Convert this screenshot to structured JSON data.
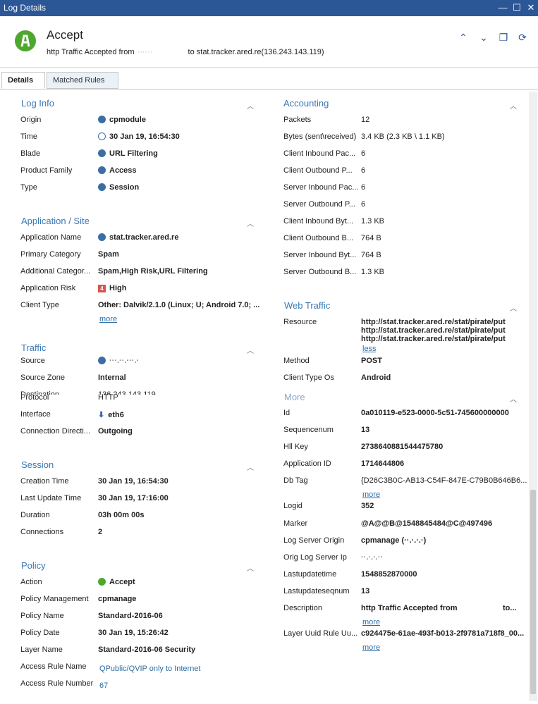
{
  "window": {
    "title": "Log Details"
  },
  "header": {
    "title": "Accept",
    "subtitle_prefix": "http Traffic Accepted from",
    "subtitle_masked": "······",
    "subtitle_suffix": "to stat.tracker.ared.re(136.243.143.119)"
  },
  "tabs": [
    {
      "label": "Details"
    },
    {
      "label": "Matched Rules"
    }
  ],
  "log_info": {
    "title": "Log Info",
    "rows": [
      {
        "label": "Origin",
        "value": "cpmodule"
      },
      {
        "label": "Time",
        "value": "30 Jan 19, 16:54:30"
      },
      {
        "label": "Blade",
        "value": "URL Filtering"
      },
      {
        "label": "Product Family",
        "value": "Access"
      },
      {
        "label": "Type",
        "value": "Session"
      }
    ]
  },
  "application": {
    "title": "Application / Site",
    "rows": [
      {
        "label": "Application Name",
        "value": "stat.tracker.ared.re"
      },
      {
        "label": "Primary Category",
        "value": "Spam"
      },
      {
        "label": "Additional Categor...",
        "value": "Spam,High Risk,URL Filtering"
      },
      {
        "label": "Application Risk",
        "value": "High",
        "badge": "4"
      },
      {
        "label": "Client Type",
        "value": "Other: Dalvik/2.1.0 (Linux; U; Android 7.0; ..."
      }
    ],
    "more": "more"
  },
  "traffic": {
    "title": "Traffic",
    "rows": [
      {
        "label": "Source",
        "value": "···.··.···.·"
      },
      {
        "label": "Source Zone",
        "value": "Internal"
      },
      {
        "label": "Destination",
        "value": "136.243.143.119"
      },
      {
        "label": "Protocol",
        "value": "HTTP"
      },
      {
        "label": "Interface",
        "value": "eth6"
      },
      {
        "label": "Connection Directi...",
        "value": "Outgoing"
      }
    ]
  },
  "session": {
    "title": "Session",
    "rows": [
      {
        "label": "Creation Time",
        "value": "30 Jan 19, 16:54:30"
      },
      {
        "label": "Last Update Time",
        "value": "30 Jan 19, 17:16:00"
      },
      {
        "label": "Duration",
        "value": "03h 00m 00s"
      },
      {
        "label": "Connections",
        "value": "2"
      }
    ]
  },
  "policy": {
    "title": "Policy",
    "rows": [
      {
        "label": "Action",
        "value": "Accept"
      },
      {
        "label": "Policy Management",
        "value": "cpmanage"
      },
      {
        "label": "Policy Name",
        "value": "Standard-2016-06"
      },
      {
        "label": "Policy Date",
        "value": "30 Jan 19, 15:26:42"
      },
      {
        "label": "Layer Name",
        "value": "Standard-2016-06 Security"
      },
      {
        "label": "Access Rule Name",
        "value": "QPublic/QVIP only to Internet"
      },
      {
        "label": "Access Rule Number",
        "value": "67"
      }
    ]
  },
  "accounting": {
    "title": "Accounting",
    "rows": [
      {
        "label": "Packets",
        "value": "12"
      },
      {
        "label": "Bytes (sent\\received)",
        "value": "3.4 KB (2.3 KB \\ 1.1 KB)"
      },
      {
        "label": "Client Inbound Pac...",
        "value": "6"
      },
      {
        "label": "Client Outbound P...",
        "value": "6"
      },
      {
        "label": "Server Inbound Pac...",
        "value": "6"
      },
      {
        "label": "Server Outbound P...",
        "value": "6"
      },
      {
        "label": "Client Inbound Byt...",
        "value": "1.3 KB"
      },
      {
        "label": "Client Outbound B...",
        "value": "764 B"
      },
      {
        "label": "Server Inbound Byt...",
        "value": "764 B"
      },
      {
        "label": "Server Outbound B...",
        "value": "1.3 KB"
      }
    ]
  },
  "web_traffic": {
    "title": "Web Traffic",
    "resource_label": "Resource",
    "resource_lines": [
      "http://stat.tracker.ared.re/stat/pirate/put",
      "http://stat.tracker.ared.re/stat/pirate/put",
      "http://stat.tracker.ared.re/stat/pirate/put"
    ],
    "less": "less",
    "rows": [
      {
        "label": "Method",
        "value": "POST"
      },
      {
        "label": "Client Type Os",
        "value": "Android"
      }
    ]
  },
  "more_section": {
    "title": "More",
    "rows": [
      {
        "label": "Id",
        "value": "0a010119-e523-0000-5c51-745600000000"
      },
      {
        "label": "Sequencenum",
        "value": "13"
      },
      {
        "label": "Hll Key",
        "value": "2738640881544475780"
      },
      {
        "label": "Application ID",
        "value": "1714644806"
      },
      {
        "label": "Db Tag",
        "value": "{D26C3B0C-AB13-C54F-847E-C79B0B646B6..."
      },
      {
        "label": "Logid",
        "value": "352"
      },
      {
        "label": "Marker",
        "value": "@A@@B@1548845484@C@497496"
      },
      {
        "label": "Log Server Origin",
        "value": "cpmanage (··.·.·.·)"
      },
      {
        "label": "Orig Log Server Ip",
        "value": "··.·.·.··"
      },
      {
        "label": "Lastupdatetime",
        "value": "1548852870000"
      },
      {
        "label": "Lastupdateseqnum",
        "value": "13"
      },
      {
        "label": "Description",
        "value": "http Traffic Accepted from",
        "value_suffix": "to..."
      },
      {
        "label": "Layer Uuid Rule Uu...",
        "value": "c924475e-61ae-493f-b013-2f9781a718f8_00..."
      }
    ],
    "more": "more"
  }
}
